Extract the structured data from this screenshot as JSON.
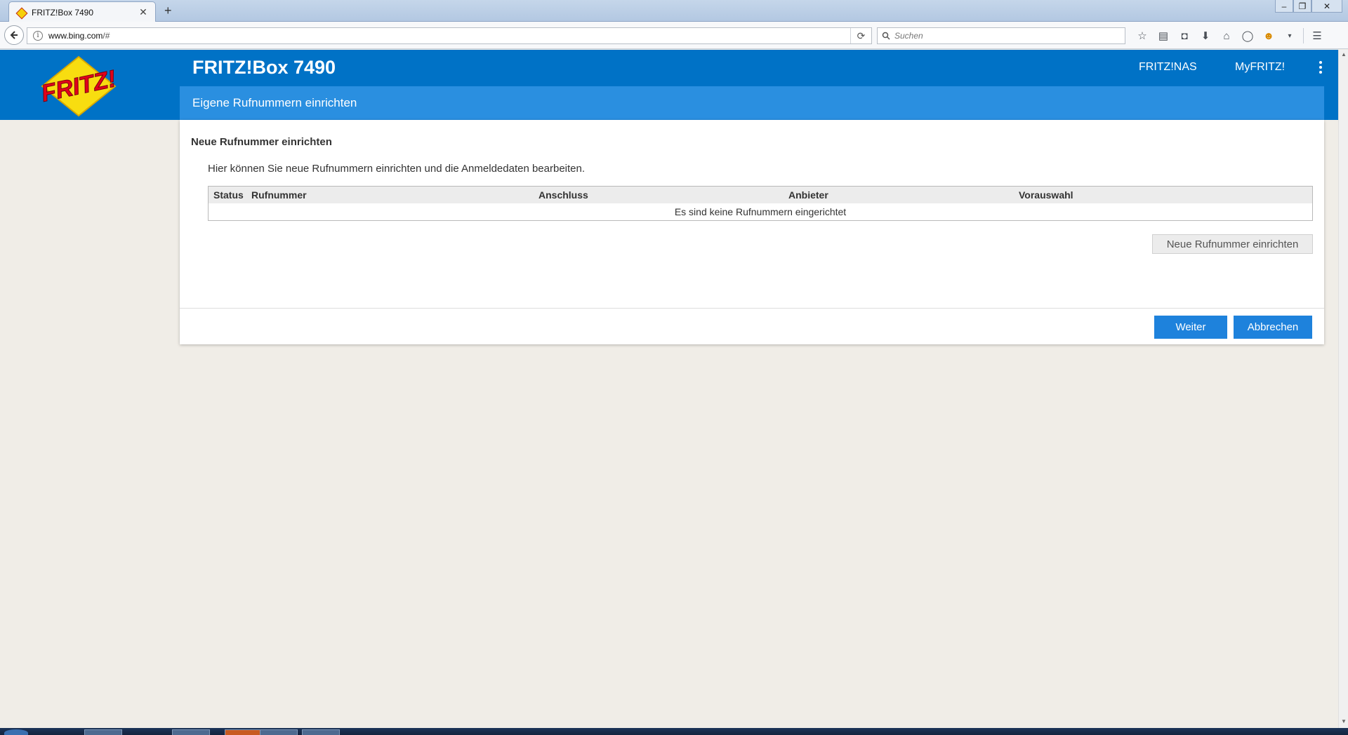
{
  "browser": {
    "tab_title": "FRITZ!Box 7490",
    "url_host": "www.bing.com",
    "url_rest": "/#",
    "search_placeholder": "Suchen"
  },
  "header": {
    "logo_text": "FRITZ!",
    "product_title": "FRITZ!Box 7490",
    "nav": [
      "FRITZ!NAS",
      "MyFRITZ!"
    ],
    "subtitle": "Eigene Rufnummern einrichten"
  },
  "card": {
    "heading": "Neue Rufnummer einrichten",
    "description": "Hier können Sie neue Rufnummern einrichten und die Anmeldedaten bearbeiten.",
    "table": {
      "columns": [
        "Status",
        "Rufnummer",
        "Anschluss",
        "Anbieter",
        "Vorauswahl"
      ],
      "empty_text": "Es sind keine Rufnummern eingerichtet"
    },
    "new_number_button": "Neue Rufnummer einrichten",
    "next_button": "Weiter",
    "cancel_button": "Abbrechen"
  },
  "colors": {
    "header_blue": "#0072c6",
    "subheader_blue": "#2a8fe0",
    "button_blue": "#1e82dc",
    "page_background": "#f0ede7"
  }
}
